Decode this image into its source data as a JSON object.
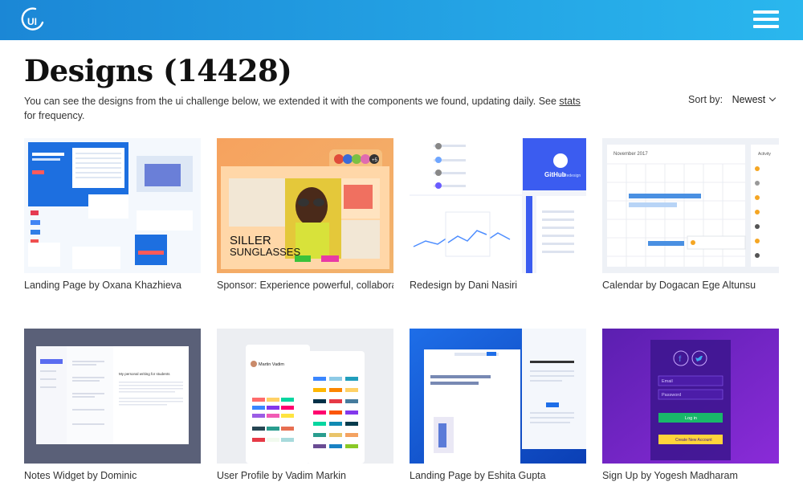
{
  "header": {
    "logo_text": "UI",
    "accent": "#1f9be3",
    "menu_icon": "hamburger-menu-icon"
  },
  "page": {
    "title": "Designs (14428)",
    "intro_before": "You can see the designs from the ui challenge below, we extended it with the components we found, updating daily. See ",
    "intro_link": "stats",
    "intro_after": " for frequency."
  },
  "sort": {
    "label": "Sort by:",
    "selected": "Newest"
  },
  "designs": [
    {
      "caption": "Landing Page by Oxana Khazhieva"
    },
    {
      "caption": "Sponsor: Experience powerful, collaborat",
      "thumb_text_1": "SILLER",
      "thumb_text_2": "SUNGLASSES",
      "badge": "+5"
    },
    {
      "caption": "Redesign by Dani Nasiri",
      "thumb_text_1": "GitHub",
      "thumb_text_2": "Redesign"
    },
    {
      "caption": "Calendar by Dogacan Ege Altunsu",
      "thumb_text_1": "November 2017",
      "thumb_text_2": "Activity"
    },
    {
      "caption": "Notes Widget by Dominic",
      "thumb_text_1": "My personal writing for students"
    },
    {
      "caption": "User Profile by Vadim Markin",
      "thumb_text_1": "Martin Vadim"
    },
    {
      "caption": "Landing Page by Eshita Gupta"
    },
    {
      "caption": "Sign Up by Yogesh Madharam",
      "thumb_text_1": "Email",
      "thumb_text_2": "Password",
      "thumb_text_3": "Log in",
      "thumb_text_4": "Create New Account"
    }
  ]
}
